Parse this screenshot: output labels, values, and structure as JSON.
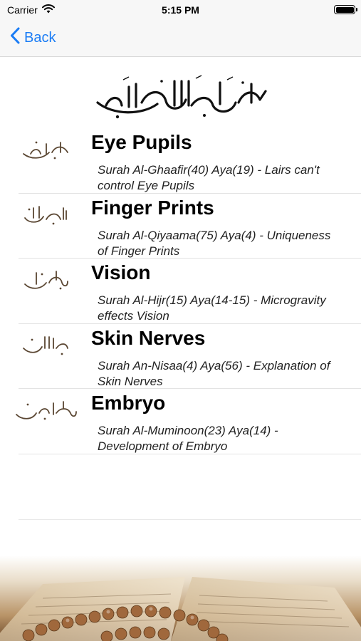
{
  "status_bar": {
    "carrier": "Carrier",
    "time": "5:15 PM",
    "wifi_icon": "wifi-icon",
    "battery_icon": "battery-icon"
  },
  "nav": {
    "back_label": "Back",
    "back_icon": "chevron-left-icon",
    "accent_color": "#1a7cf5"
  },
  "header": {
    "image": "basmala-calligraphy"
  },
  "items": [
    {
      "title": "Eye Pupils",
      "subtitle": "Surah Al-Ghaafir(40) Aya(19) - Lairs can't control Eye Pupils",
      "label_image": "surah-ghafir-calligraphy"
    },
    {
      "title": "Finger Prints",
      "subtitle": "Surah Al-Qiyaama(75) Aya(4) - Uniqueness of Finger Prints",
      "label_image": "surah-qiyama-calligraphy"
    },
    {
      "title": "Vision",
      "subtitle": "Surah Al-Hijr(15) Aya(14-15) - Microgravity effects Vision",
      "label_image": "surah-hijr-calligraphy"
    },
    {
      "title": "Skin Nerves",
      "subtitle": "Surah An-Nisaa(4) Aya(56) - Explanation of Skin Nerves",
      "label_image": "surah-nisa-calligraphy"
    },
    {
      "title": "Embryo",
      "subtitle": "Surah Al-Muminoon(23) Aya(14) - Development of Embryo",
      "label_image": "surah-muminoon-calligraphy"
    }
  ],
  "footer": {
    "image": "quran-and-prayer-beads-photo"
  }
}
